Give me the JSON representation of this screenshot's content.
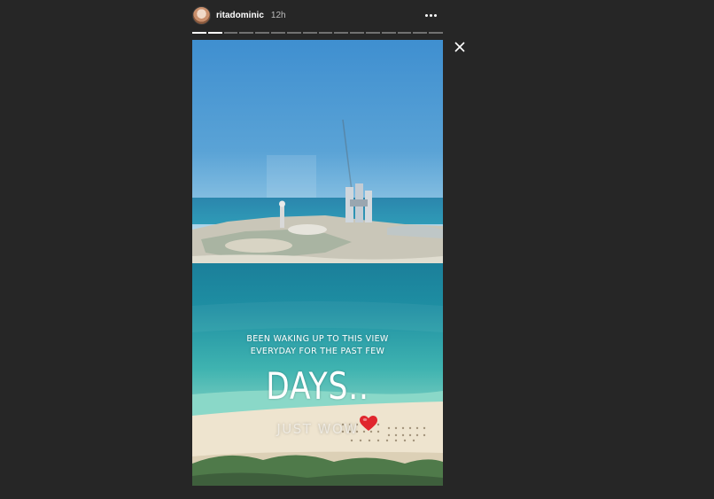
{
  "story": {
    "username": "ritadominic",
    "time": "12h",
    "progress": {
      "total": 16,
      "viewed": 2
    },
    "caption": {
      "line1": "BEEN WAKING UP TO THIS VIEW",
      "line2": "EVERYDAY FOR THE PAST FEW",
      "big": "DAYS..",
      "small": "JUST WOW"
    }
  },
  "icons": {
    "more": "more-options-icon",
    "close": "close-icon",
    "heart": "heart-icon"
  },
  "colors": {
    "background": "#262626",
    "sky": "#5aa3d6",
    "sea": "#1f9aa6",
    "sand": "#eee4cf",
    "heart": "#e0262d"
  }
}
